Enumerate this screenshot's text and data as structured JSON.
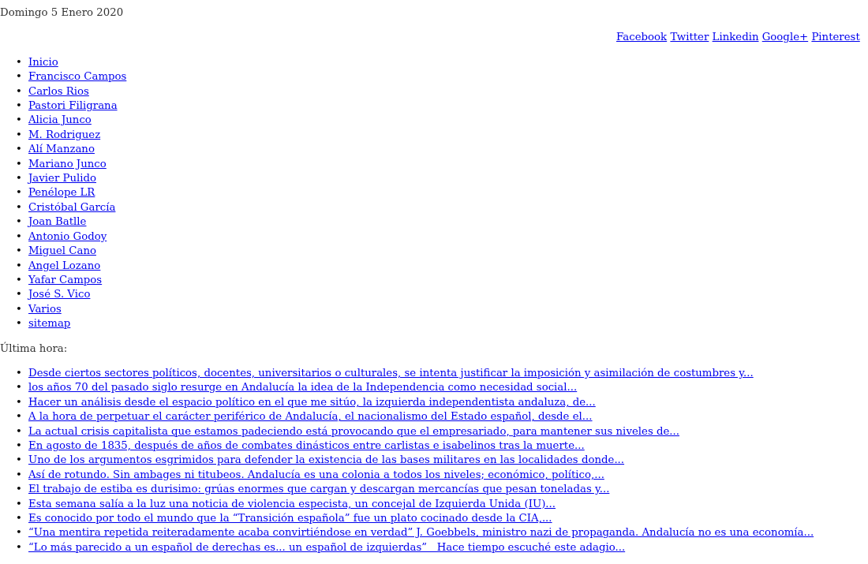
{
  "date": "Domingo 5 Enero 2020",
  "social_links": [
    "Facebook",
    "Twitter",
    "Linkedin",
    "Google+",
    "Pinterest"
  ],
  "nav_items": [
    {
      "marker": "•",
      "label": "Inicio"
    },
    {
      "marker": "•",
      "label": "Francisco Campos"
    },
    {
      "marker": "•",
      "label": "Carlos Rios"
    },
    {
      "marker": "•",
      "label": "Pastori Filigrana"
    },
    {
      "marker": "•",
      "label": "Alicia Junco"
    },
    {
      "marker": "•",
      "label": "M. Rodriguez"
    },
    {
      "marker": "•",
      "label": "Alí Manzano"
    },
    {
      "marker": "•",
      "label": "Mariano Junco"
    },
    {
      "marker": "•",
      "label": "Javier Pulido"
    },
    {
      "marker": "•",
      "label": "Penélope LR"
    },
    {
      "marker": "•",
      "label": "Cristóbal García"
    },
    {
      "marker": "•",
      "label": "Joan Batlle"
    },
    {
      "marker": "•",
      "label": "Antonio Godoy"
    },
    {
      "marker": "•",
      "label": "Miguel Cano"
    },
    {
      "marker": "•",
      "label": "Angel Lozano"
    },
    {
      "marker": "•",
      "label": "Yafar Campos"
    },
    {
      "marker": "•",
      "label": "José S. Vico"
    },
    {
      "marker": "•",
      "label": "Varios"
    },
    {
      "marker": "•",
      "label": "sitemap"
    }
  ],
  "breaking_news": {
    "heading": "Última hora:",
    "items": [
      {
        "marker": "•",
        "label": "Desde ciertos sectores políticos, docentes, universitarios o culturales, se intenta justificar la imposición y asimilación de costumbres y..."
      },
      {
        "marker": "•",
        "label": "los años 70 del pasado siglo resurge en Andalucía la idea de la Independencia como necesidad social..."
      },
      {
        "marker": "•",
        "label": "Hacer un análisis desde el espacio político en el que me sitúo, la izquierda independentista andaluza, de..."
      },
      {
        "marker": "•",
        "label": "A la hora de perpetuar el carácter periférico de Andalucía, el nacionalismo del Estado español, desde el..."
      },
      {
        "marker": "•",
        "label": "La actual crisis capitalista que estamos padeciendo está provocando que el empresariado, para mantener sus niveles de..."
      },
      {
        "marker": "•",
        "label": "En agosto de 1835, después de años de combates dinásticos entre carlistas e isabelinos tras la muerte..."
      },
      {
        "marker": "•",
        "label": "Uno de los argumentos esgrimidos para defender la existencia de las bases militares en las localidades donde..."
      },
      {
        "marker": "•",
        "label": "Así de rotundo. Sin ambages ni titubeos. Andalucía es una colonia a todos los niveles; económico, político,..."
      },
      {
        "marker": "•",
        "label": "El trabajo de estiba es durisimo: grúas enormes que cargan y descargan mercancías que pesan toneladas y..."
      },
      {
        "marker": "•",
        "label": "Esta semana salía a la luz una noticia de violencia especista, un concejal de Izquierda Unida (IU)..."
      },
      {
        "marker": "•",
        "label": "Es conocido por todo el mundo que la “Transición española” fue un plato cocinado desde la CIA,..."
      },
      {
        "marker": "•",
        "label": "“Una mentira repetida reiteradamente acaba convirtiéndose en verdad” J. Goebbels, ministro nazi de propaganda. Andalucía no es una economía..."
      },
      {
        "marker": "•",
        "label": "“Lo más parecido a un español de derechas es... un español de izquierdas”   Hace tiempo escuché este adagio..."
      }
    ]
  }
}
